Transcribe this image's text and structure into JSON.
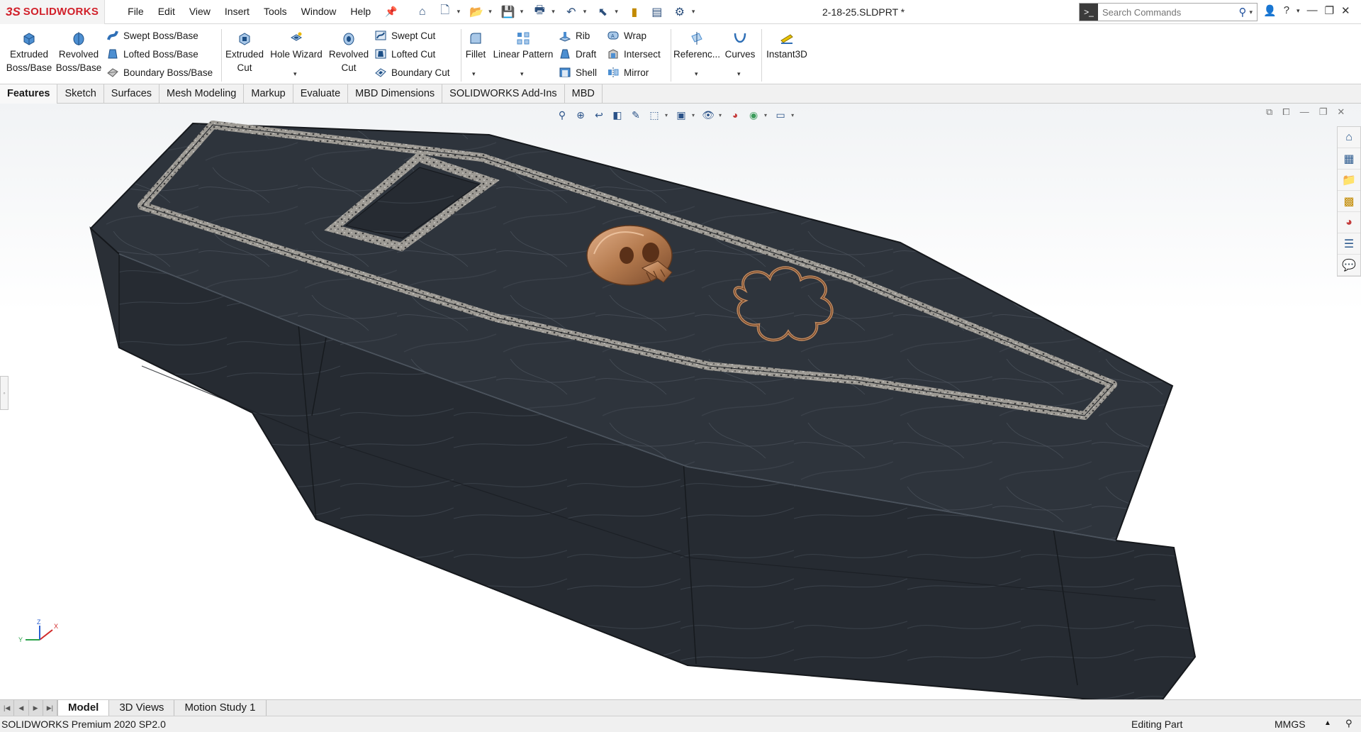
{
  "app": {
    "brand_ds": "3S",
    "brand_name": "SOLIDWORKS",
    "document_title": "2-18-25.SLDPRT *"
  },
  "menu": [
    "File",
    "Edit",
    "View",
    "Insert",
    "Tools",
    "Window",
    "Help"
  ],
  "search": {
    "placeholder": "Search Commands"
  },
  "ribbon": {
    "extruded_boss": [
      "Extruded",
      "Boss/Base"
    ],
    "revolved_boss": [
      "Revolved",
      "Boss/Base"
    ],
    "swept_boss": "Swept Boss/Base",
    "lofted_boss": "Lofted Boss/Base",
    "boundary_boss": "Boundary Boss/Base",
    "extruded_cut": [
      "Extruded",
      "Cut"
    ],
    "hole_wizard": "Hole Wizard",
    "revolved_cut": [
      "Revolved",
      "Cut"
    ],
    "swept_cut": "Swept Cut",
    "lofted_cut": "Lofted Cut",
    "boundary_cut": "Boundary Cut",
    "fillet": "Fillet",
    "linear_pattern": "Linear Pattern",
    "rib": "Rib",
    "draft": "Draft",
    "shell": "Shell",
    "wrap": "Wrap",
    "intersect": "Intersect",
    "mirror": "Mirror",
    "reference": "Referenc...",
    "curves": "Curves",
    "instant3d": "Instant3D"
  },
  "tabs": [
    "Features",
    "Sketch",
    "Surfaces",
    "Mesh Modeling",
    "Markup",
    "Evaluate",
    "MBD Dimensions",
    "SOLIDWORKS Add-Ins",
    "MBD"
  ],
  "active_tab": "Features",
  "bottom_tabs": [
    "Model",
    "3D Views",
    "Motion Study 1"
  ],
  "active_bottom_tab": "Model",
  "status": {
    "product": "SOLIDWORKS Premium 2020 SP2.0",
    "mode": "Editing Part",
    "units": "MMGS"
  },
  "triad": {
    "x": "X",
    "y": "Y",
    "z": "Z"
  },
  "colors": {
    "brand_red": "#d1202a",
    "slate": "#2e333b",
    "inlay": "#8c8a86",
    "bronze": "#b98056"
  }
}
